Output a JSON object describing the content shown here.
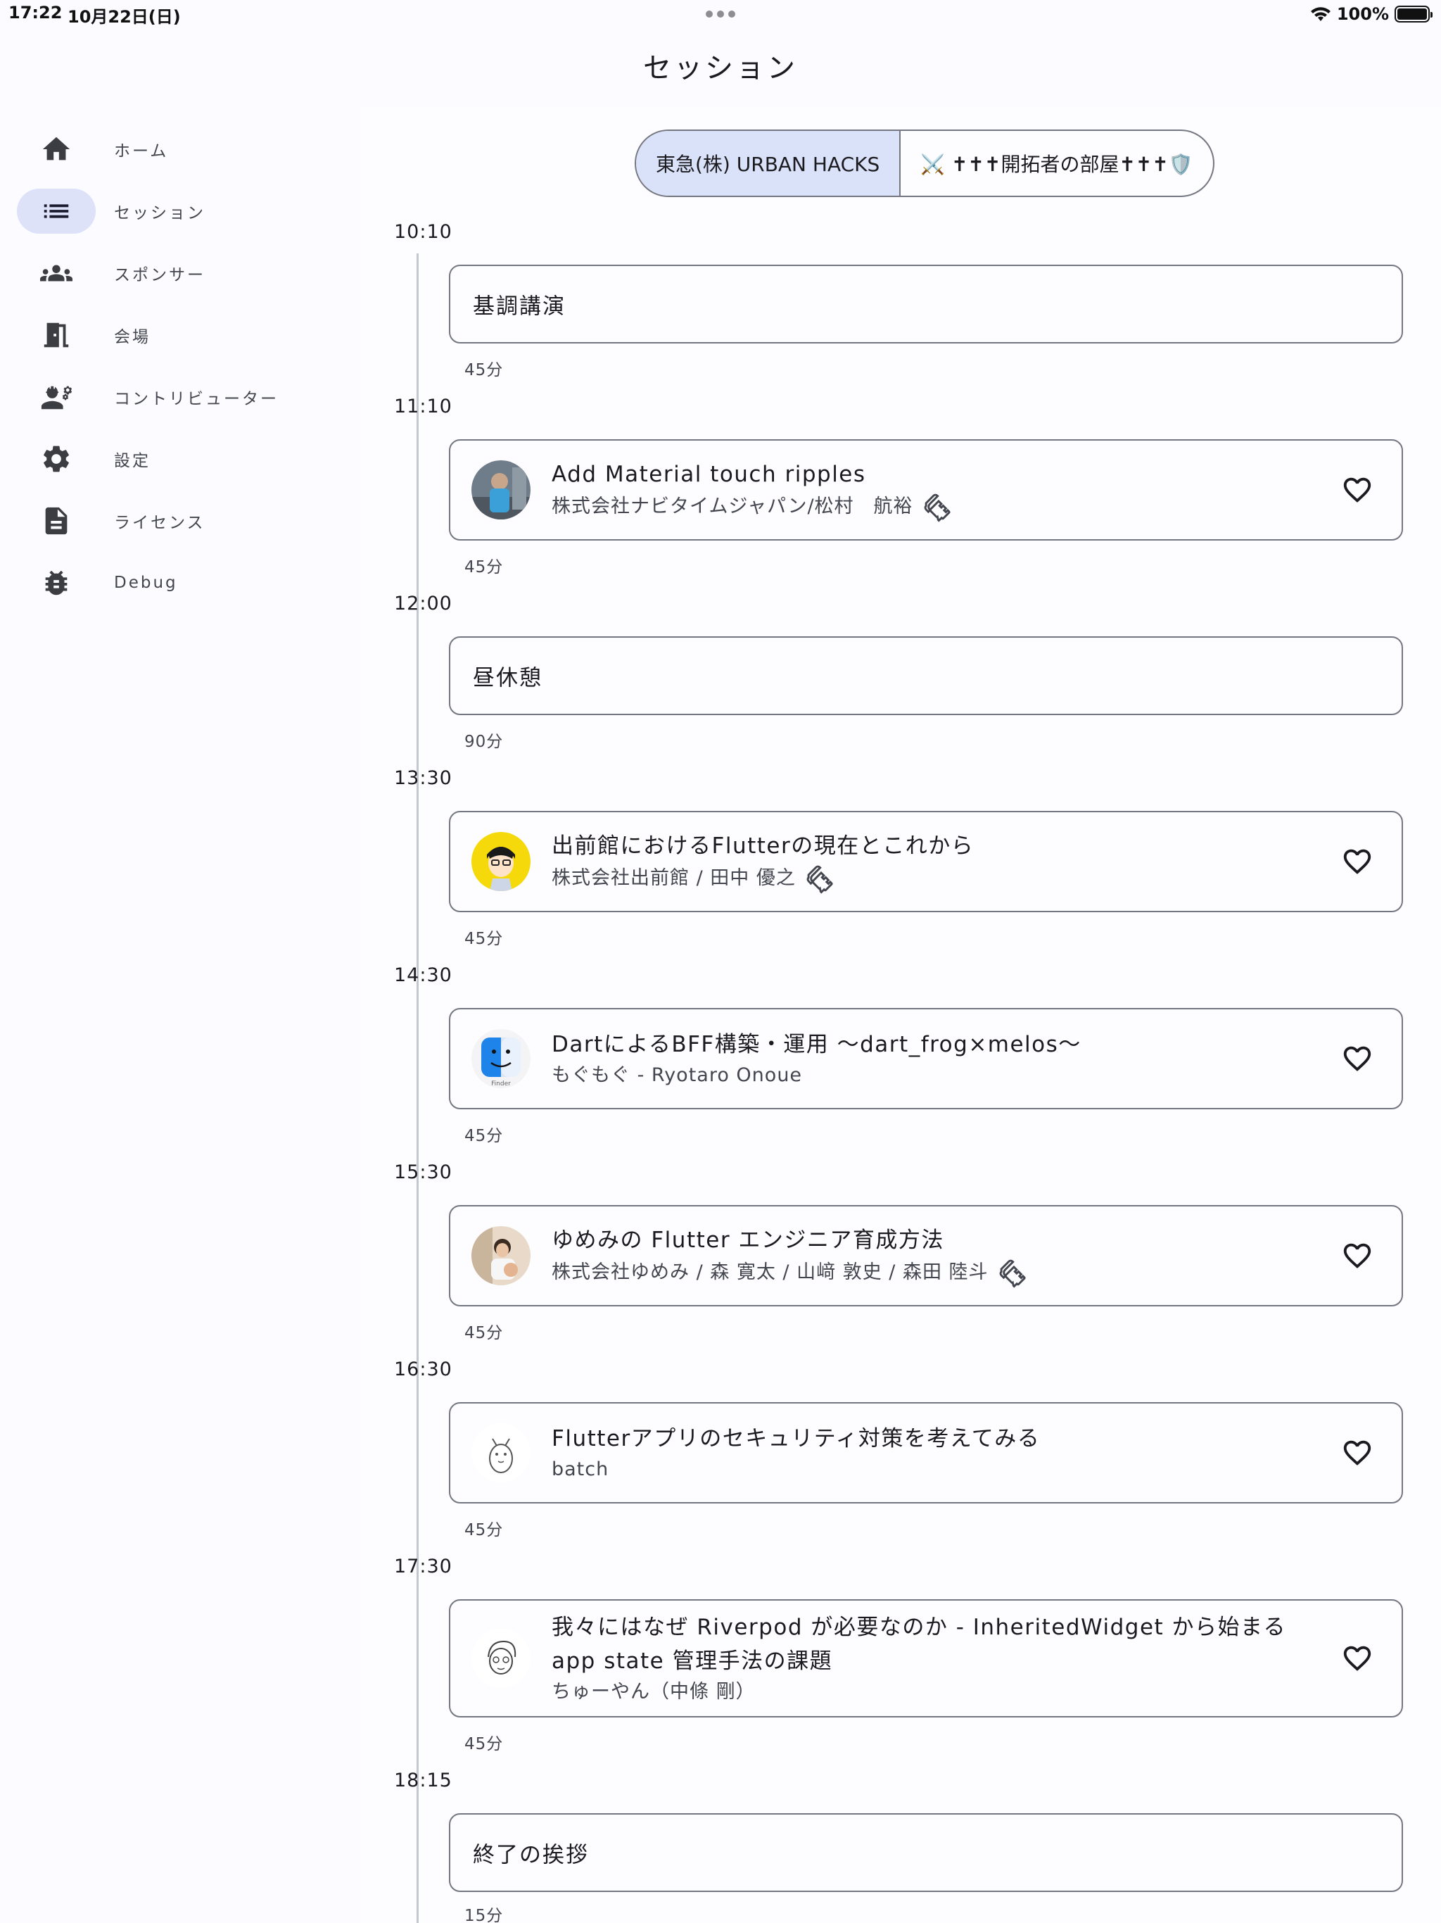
{
  "status_bar": {
    "time": "17:22",
    "date": "10月22日(日)",
    "battery": "100%"
  },
  "title": "セッション",
  "sidebar": {
    "items": [
      {
        "label": "ホーム",
        "icon": "home-icon"
      },
      {
        "label": "セッション",
        "icon": "list-icon",
        "active": true
      },
      {
        "label": "スポンサー",
        "icon": "groups-icon"
      },
      {
        "label": "会場",
        "icon": "door-icon"
      },
      {
        "label": "コントリビューター",
        "icon": "engineering-icon"
      },
      {
        "label": "設定",
        "icon": "gear-icon"
      },
      {
        "label": "ライセンス",
        "icon": "document-icon"
      },
      {
        "label": "Debug",
        "icon": "bug-icon"
      }
    ]
  },
  "rooms": {
    "selected": "東急(株) URBAN HACKS",
    "other": "⚔️ ✝✝✝開拓者の部屋✝✝✝🛡️"
  },
  "sessions": [
    {
      "time": "10:10",
      "title": "基調講演",
      "duration": "45分",
      "kind": "simple"
    },
    {
      "time": "11:10",
      "title": "Add Material touch ripples",
      "speaker": "株式会社ナビタイムジャパン/松村　航裕",
      "duration": "45分",
      "kind": "talk",
      "handson": true,
      "avatar": "photo-blue"
    },
    {
      "time": "12:00",
      "title": "昼休憩",
      "duration": "90分",
      "kind": "simple"
    },
    {
      "time": "13:30",
      "title": "出前館におけるFlutterの現在とこれから",
      "speaker": "株式会社出前館 / 田中 優之",
      "duration": "45分",
      "kind": "talk",
      "handson": true,
      "avatar": "illust-yellow"
    },
    {
      "time": "14:30",
      "title": "DartによるBFF構築・運用 〜dart_frog×melos〜",
      "speaker": "もぐもぐ - Ryotaro Onoue",
      "duration": "45分",
      "kind": "talk",
      "handson": false,
      "avatar": "finder"
    },
    {
      "time": "15:30",
      "title": "ゆめみの Flutter エンジニア育成方法",
      "speaker": "株式会社ゆめみ / 森 寛太 / 山﨑 敦史 / 森田 陸斗",
      "duration": "45分",
      "kind": "talk",
      "handson": true,
      "avatar": "photo-people"
    },
    {
      "time": "16:30",
      "title": "Flutterアプリのセキュリティ対策を考えてみる",
      "speaker": "batch",
      "duration": "45分",
      "kind": "talk",
      "handson": false,
      "avatar": "sketch-cat"
    },
    {
      "time": "17:30",
      "title": "我々にはなぜ Riverpod が必要なのか - InheritedWidget から始まる app state 管理手法の課題",
      "speaker": "ちゅーやん（中條 剛）",
      "duration": "45分",
      "kind": "talk",
      "handson": false,
      "avatar": "sketch-face"
    },
    {
      "time": "18:15",
      "title": "終了の挨拶",
      "duration": "15分",
      "kind": "simple"
    }
  ],
  "colors": {
    "accent_container": "#dae2f9",
    "outline": "#74777f",
    "surface": "#fdfcff"
  }
}
